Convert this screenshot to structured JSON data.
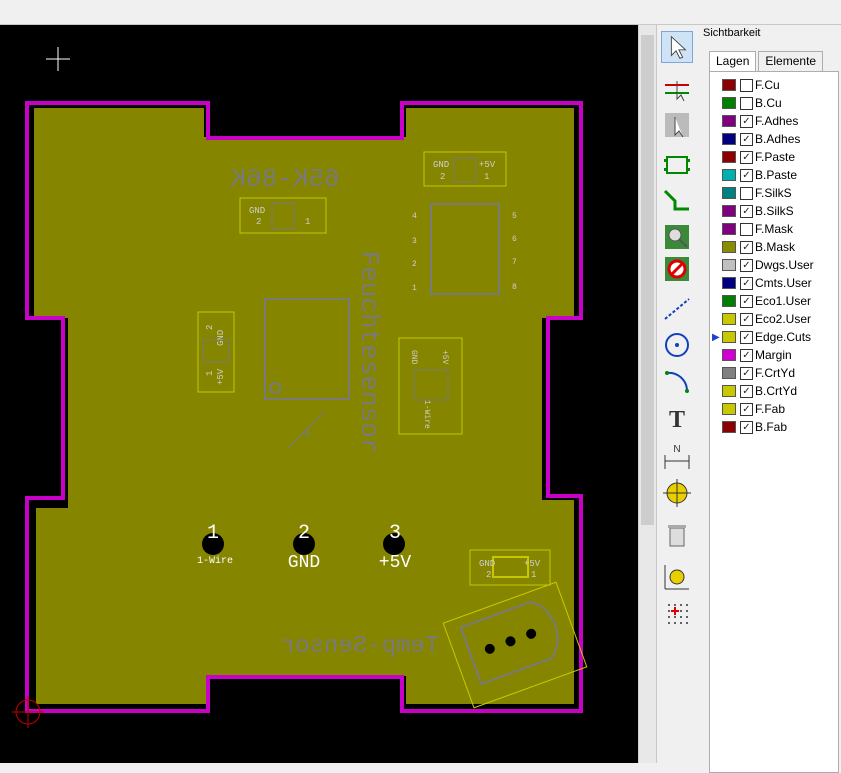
{
  "panel": {
    "title": "Sichtbarkeit",
    "tabs": [
      {
        "label": "Lagen",
        "active": true
      },
      {
        "label": "Elemente",
        "active": false
      }
    ],
    "layers": [
      {
        "name": "F.Cu",
        "color": "#8b0000",
        "visible": false
      },
      {
        "name": "B.Cu",
        "color": "#008000",
        "visible": false
      },
      {
        "name": "F.Adhes",
        "color": "#800080",
        "visible": true
      },
      {
        "name": "B.Adhes",
        "color": "#000080",
        "visible": true
      },
      {
        "name": "F.Paste",
        "color": "#8b0000",
        "visible": true
      },
      {
        "name": "B.Paste",
        "color": "#00b0b0",
        "visible": true
      },
      {
        "name": "F.SilkS",
        "color": "#008080",
        "visible": false
      },
      {
        "name": "B.SilkS",
        "color": "#800080",
        "visible": true
      },
      {
        "name": "F.Mask",
        "color": "#800080",
        "visible": false
      },
      {
        "name": "B.Mask",
        "color": "#8b8b00",
        "visible": true
      },
      {
        "name": "Dwgs.User",
        "color": "#c0c0c0",
        "visible": true
      },
      {
        "name": "Cmts.User",
        "color": "#000080",
        "visible": true
      },
      {
        "name": "Eco1.User",
        "color": "#008000",
        "visible": true
      },
      {
        "name": "Eco2.User",
        "color": "#c8c800",
        "visible": true
      },
      {
        "name": "Edge.Cuts",
        "color": "#c8c800",
        "visible": true,
        "selected": true
      },
      {
        "name": "Margin",
        "color": "#d000d0",
        "visible": true
      },
      {
        "name": "F.CrtYd",
        "color": "#808080",
        "visible": true
      },
      {
        "name": "B.CrtYd",
        "color": "#c8c800",
        "visible": true
      },
      {
        "name": "F.Fab",
        "color": "#c8c800",
        "visible": true
      },
      {
        "name": "B.Fab",
        "color": "#8b0000",
        "visible": true
      }
    ]
  },
  "toolbar": {
    "tools": [
      {
        "name": "select-arrow-icon",
        "active": true
      },
      {
        "name": "highlight-net-icon"
      },
      {
        "name": "local-ratsnest-icon"
      },
      {
        "name": "add-footprint-icon"
      },
      {
        "name": "route-track-icon"
      },
      {
        "name": "add-via-icon"
      },
      {
        "name": "add-keepout-zone-icon"
      },
      {
        "name": "draw-line-icon"
      },
      {
        "name": "draw-circle-icon"
      },
      {
        "name": "draw-arc-icon"
      },
      {
        "name": "add-text-icon"
      },
      {
        "name": "add-dimension-icon"
      },
      {
        "name": "layer-target-icon"
      },
      {
        "name": "delete-trash-icon"
      },
      {
        "name": "set-origin-icon"
      },
      {
        "name": "grid-origin-icon"
      }
    ]
  },
  "board": {
    "colors": {
      "mask": "#858500",
      "edge": "#c800c8",
      "silk": "#7a7a7a",
      "fab": "#c8c800",
      "fabtext": "#cfcfcf"
    },
    "labels": {
      "id": "65K-86K",
      "feuchte": "Feuchtesensor",
      "temp": "Temp-Sensor",
      "four": "4",
      "pad1_num": "1",
      "pad1_name": "1-Wire",
      "pad2_num": "2",
      "pad2_name": "GND",
      "pad3_num": "3",
      "pad3_name": "+5V",
      "jtop_gnd": "GND",
      "jtop_5v": "+5V",
      "jtop_2": "2",
      "jtop_1": "1",
      "jleft_gnd": "GND",
      "jleft_2": "2",
      "jleft_1": "1",
      "jside_gnd": "GND",
      "jside_2": "2",
      "jside_5v": "+5V",
      "jside_1": "1",
      "jmid_gnd": "GND",
      "jmid_1": "1",
      "jmid_5v": "+5V",
      "jmid_2": "2",
      "jmid_3": "3",
      "jmid_1w": "1-Wire",
      "jbot_gnd": "GND",
      "jbot_5v": "+5V",
      "jbot_2": "2",
      "jbot_1": "1",
      "ic_4": "4",
      "ic_3": "3",
      "ic_2": "2",
      "ic_1": "1",
      "ic_5": "5",
      "ic_6": "6",
      "ic_7": "7",
      "ic_8": "8"
    }
  }
}
